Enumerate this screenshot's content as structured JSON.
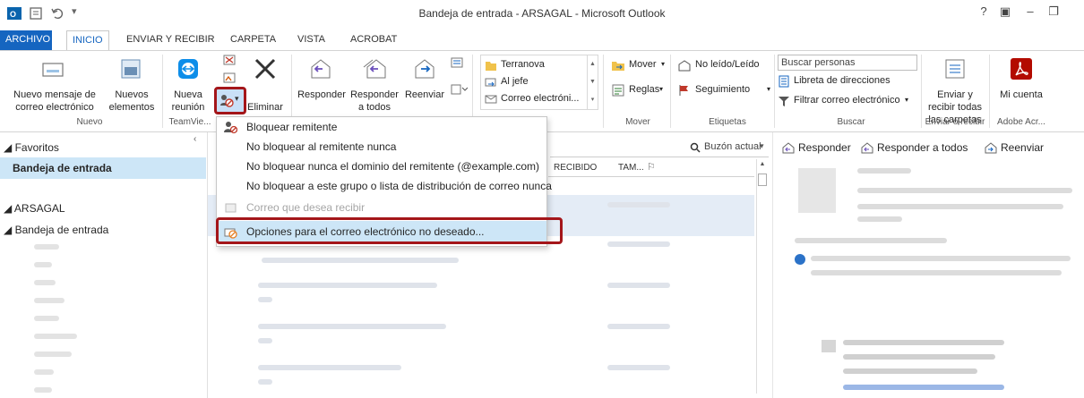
{
  "window": {
    "title": "Bandeja de entrada - ARSAGAL - Microsoft Outlook"
  },
  "window_controls": [
    "?",
    "▣",
    "–",
    "❐"
  ],
  "tabs": [
    {
      "label": "ARCHIVO"
    },
    {
      "label": "INICIO"
    },
    {
      "label": "ENVIAR Y RECIBIR"
    },
    {
      "label": "CARPETA"
    },
    {
      "label": "VISTA"
    },
    {
      "label": "ACROBAT"
    }
  ],
  "ribbon": {
    "nuevo_mensaje": "Nuevo mensaje de correo electrónico",
    "nuevos_elementos": "Nuevos elementos",
    "nueva_reunion": "Nueva reunión",
    "eliminar": "Eliminar",
    "responder": "Responder",
    "responder_todos": "Responder a todos",
    "reenviar": "Reenviar",
    "quick_steps": [
      "Terranova",
      "Al jefe",
      "Correo electróni..."
    ],
    "mover": "Mover",
    "reglas": "Reglas",
    "no_leido": "No leído/Leído",
    "seguimiento": "Seguimiento",
    "buscar_personas": "Buscar personas",
    "libreta": "Libreta de direcciones",
    "filtrar": "Filtrar correo electrónico",
    "enviar_recibir": "Enviar y recibir todas las carpetas",
    "mi_cuenta": "Mi cuenta",
    "groups": [
      "Nuevo",
      "TeamVie...",
      "Mover",
      "Etiquetas",
      "Buscar",
      "Enviar o recibir",
      "Adobe Acr..."
    ]
  },
  "leftnav": {
    "favoritos": "◢ Favoritos",
    "bandeja_fav": "Bandeja de entrada",
    "account": "◢ ARSAGAL",
    "bandeja": "◢ Bandeja de entrada"
  },
  "maillist": {
    "search_scope": "Buzón actual",
    "col_recibido": "RECIBIDO",
    "col_tam": "TAM..."
  },
  "reading": {
    "responder": "Responder",
    "responder_todos": "Responder a todos",
    "reenviar": "Reenviar"
  },
  "junk_menu": [
    {
      "label": "Bloquear remitente",
      "disabled": false,
      "icon": "block-sender-icon"
    },
    {
      "label": "No bloquear al remitente nunca",
      "disabled": false
    },
    {
      "label": "No bloquear nunca el dominio del remitente (@example.com)",
      "disabled": false
    },
    {
      "label": "No bloquear a este grupo o lista de distribución de correo nunca",
      "disabled": false
    },
    {
      "label": "Correo que desea recibir",
      "disabled": true
    },
    {
      "label": "Opciones para el correo electrónico no deseado...",
      "disabled": false,
      "highlighted": true
    }
  ],
  "colors": {
    "accent": "#1565c0",
    "highlight_box": "#a4161a",
    "menu_highlight": "#cde6f7"
  }
}
